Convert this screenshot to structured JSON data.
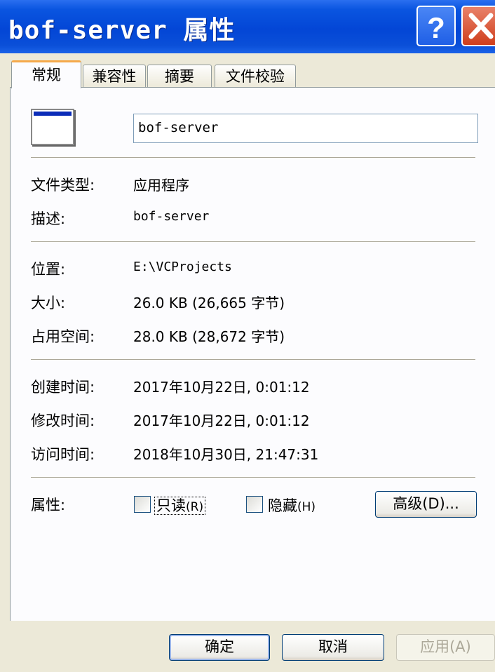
{
  "window": {
    "title": "bof-server 属性",
    "help_label": "?",
    "close_label": "×"
  },
  "tabs": [
    {
      "label": "常规",
      "active": true
    },
    {
      "label": "兼容性",
      "active": false
    },
    {
      "label": "摘要",
      "active": false
    },
    {
      "label": "文件校验",
      "active": false
    }
  ],
  "general": {
    "file_name": "bof-server",
    "file_type_label": "文件类型:",
    "file_type": "应用程序",
    "description_label": "描述:",
    "description": "bof-server",
    "location_label": "位置:",
    "location": "E:\\VCProjects",
    "size_label": "大小:",
    "size": "26.0 KB (26,665 字节)",
    "disk_size_label": "占用空间:",
    "disk_size": "28.0 KB (28,672 字节)",
    "created_label": "创建时间:",
    "created": "2017年10月22日, 0:01:12",
    "modified_label": "修改时间:",
    "modified": "2017年10月22日, 0:01:12",
    "accessed_label": "访问时间:",
    "accessed": "2018年10月30日, 21:47:31",
    "attributes_label": "属性:",
    "readonly_label": "只读",
    "readonly_key": "(R)",
    "readonly_checked": false,
    "hidden_label": "隐藏",
    "hidden_key": "(H)",
    "hidden_checked": false,
    "advanced_label": "高级(D)..."
  },
  "footer": {
    "ok_label": "确定",
    "cancel_label": "取消",
    "apply_label": "应用(A)"
  },
  "colors": {
    "titlebar": "#0346d6",
    "tab_highlight": "#f5a94a",
    "dialog_bg": "#ece9d8"
  }
}
